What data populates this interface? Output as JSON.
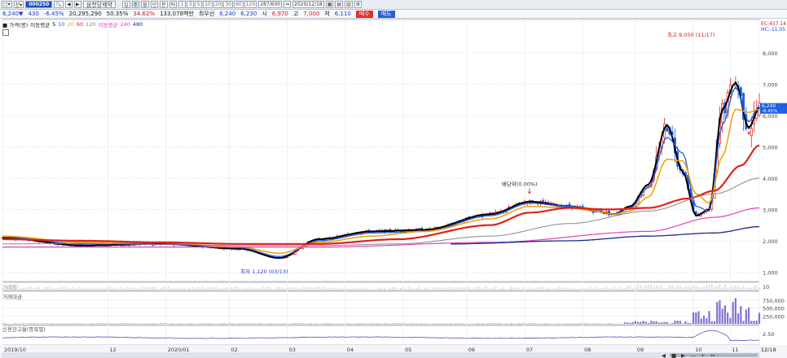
{
  "toolbar": {
    "code": "000250",
    "name": "삼천당제약",
    "periods": [
      "1",
      "3",
      "5",
      "10",
      "20",
      "30",
      "60",
      "120"
    ],
    "count": "287/600",
    "date": "2020/12/18"
  },
  "quote": {
    "price": "6,240▼",
    "change": "430",
    "pct": "-6.45%",
    "volume": "20,295,290",
    "ratio": "50.35%",
    "turnover": "34.62%",
    "value": "133,078백만",
    "bid_label": "최우선",
    "bid": "6,240",
    "ask": "6,230",
    "open_label": "시",
    "open": "6,970",
    "high_label": "고",
    "high": "7,000",
    "low_label": "저",
    "low": "6,110",
    "buy": "매수",
    "sell": "매도"
  },
  "legend": {
    "price_title": "■ 가격(봉)",
    "ma_title": "이동평균",
    "ma_periods": [
      "5",
      "10",
      "20",
      "60",
      "120"
    ],
    "ma2_title": "이동평균",
    "ma2_periods": [
      "240",
      "480"
    ],
    "volume_title": "거래량",
    "value_title": "거래대금",
    "credit_title": "신용잔고율(종목별)"
  },
  "colors": {
    "ma5": "#000000",
    "ma10": "#1f5fe0",
    "ma20": "#f0a000",
    "ma60": "#e0201e",
    "ma120": "#888888",
    "ma240": "#e040c0",
    "ma480": "#1a2a8c",
    "up": "#e0201e",
    "down": "#1f5fe0"
  },
  "chart_data": {
    "type": "line",
    "y_axis_ticks": [
      "1,000",
      "2,000",
      "3,000",
      "4,000",
      "5,000",
      "6,000",
      "7,000",
      "8,000"
    ],
    "x_axis_ticks": [
      "2019/10",
      "12",
      "2020/01",
      "02",
      "03",
      "04",
      "05",
      "06",
      "07",
      "08",
      "09",
      "10",
      "11",
      "12",
      "12/18"
    ],
    "annotations": {
      "max": "최고 9,050 (11/17)",
      "min": "최저 1,120 (03/13)",
      "dividend": "배당락(0.00%)"
    },
    "last_price_label": "6,240",
    "last_change_label": "-6.45%",
    "top_right_labels": [
      "EC:457.14",
      "HC:-11.05"
    ],
    "volume_ticks": [
      "10"
    ],
    "value_ticks": [
      "750,000",
      "500,000",
      "250,000"
    ],
    "credit_ticks": [
      "2.50"
    ],
    "series": [
      {
        "name": "5",
        "x": [
          0,
          30,
          60,
          90,
          105,
          120,
          140,
          160,
          185,
          200,
          215,
          225,
          232,
          238,
          245,
          252,
          258,
          263,
          268,
          273,
          278,
          283,
          287
        ],
        "y": [
          2100,
          1850,
          1900,
          1750,
          1450,
          2050,
          2300,
          2350,
          2850,
          3250,
          3100,
          2950,
          2850,
          3100,
          3800,
          5700,
          4200,
          2800,
          3000,
          6200,
          7050,
          5600,
          6250
        ]
      },
      {
        "name": "10",
        "x": [
          0,
          30,
          60,
          90,
          105,
          120,
          140,
          160,
          185,
          200,
          215,
          225,
          232,
          238,
          245,
          252,
          258,
          263,
          268,
          273,
          278,
          283,
          287
        ],
        "y": [
          2120,
          1900,
          1920,
          1780,
          1500,
          2000,
          2250,
          2300,
          2800,
          3200,
          3100,
          2950,
          2850,
          3050,
          3700,
          5300,
          4800,
          3100,
          2950,
          5700,
          6900,
          5800,
          6300
        ]
      },
      {
        "name": "20",
        "x": [
          0,
          30,
          60,
          90,
          105,
          120,
          140,
          160,
          185,
          200,
          215,
          225,
          232,
          238,
          245,
          252,
          258,
          263,
          268,
          273,
          278,
          283,
          287
        ],
        "y": [
          2150,
          1950,
          1950,
          1800,
          1600,
          1950,
          2150,
          2300,
          2700,
          3100,
          3050,
          2950,
          2850,
          2950,
          3400,
          4600,
          4550,
          3500,
          3200,
          4700,
          6200,
          6100,
          6200
        ]
      },
      {
        "name": "60",
        "x": [
          0,
          30,
          60,
          90,
          120,
          150,
          185,
          200,
          215,
          230,
          245,
          260,
          270,
          280,
          287
        ],
        "y": [
          2050,
          2000,
          1950,
          1900,
          1900,
          2050,
          2500,
          2900,
          3050,
          3000,
          3050,
          3350,
          3600,
          4400,
          5050
        ]
      },
      {
        "name": "120",
        "x": [
          0,
          30,
          60,
          90,
          120,
          150,
          185,
          215,
          245,
          270,
          287
        ],
        "y": [
          1900,
          1920,
          1880,
          1850,
          1850,
          1900,
          2150,
          2550,
          2950,
          3500,
          4000
        ]
      },
      {
        "name": "240",
        "x": [
          0,
          60,
          120,
          185,
          245,
          270,
          287
        ],
        "y": [
          1800,
          1800,
          1800,
          1950,
          2300,
          2750,
          3050
        ]
      },
      {
        "name": "480",
        "x": [
          170,
          215,
          245,
          270,
          287
        ],
        "y": [
          1900,
          2000,
          2150,
          2250,
          2450
        ]
      }
    ]
  }
}
